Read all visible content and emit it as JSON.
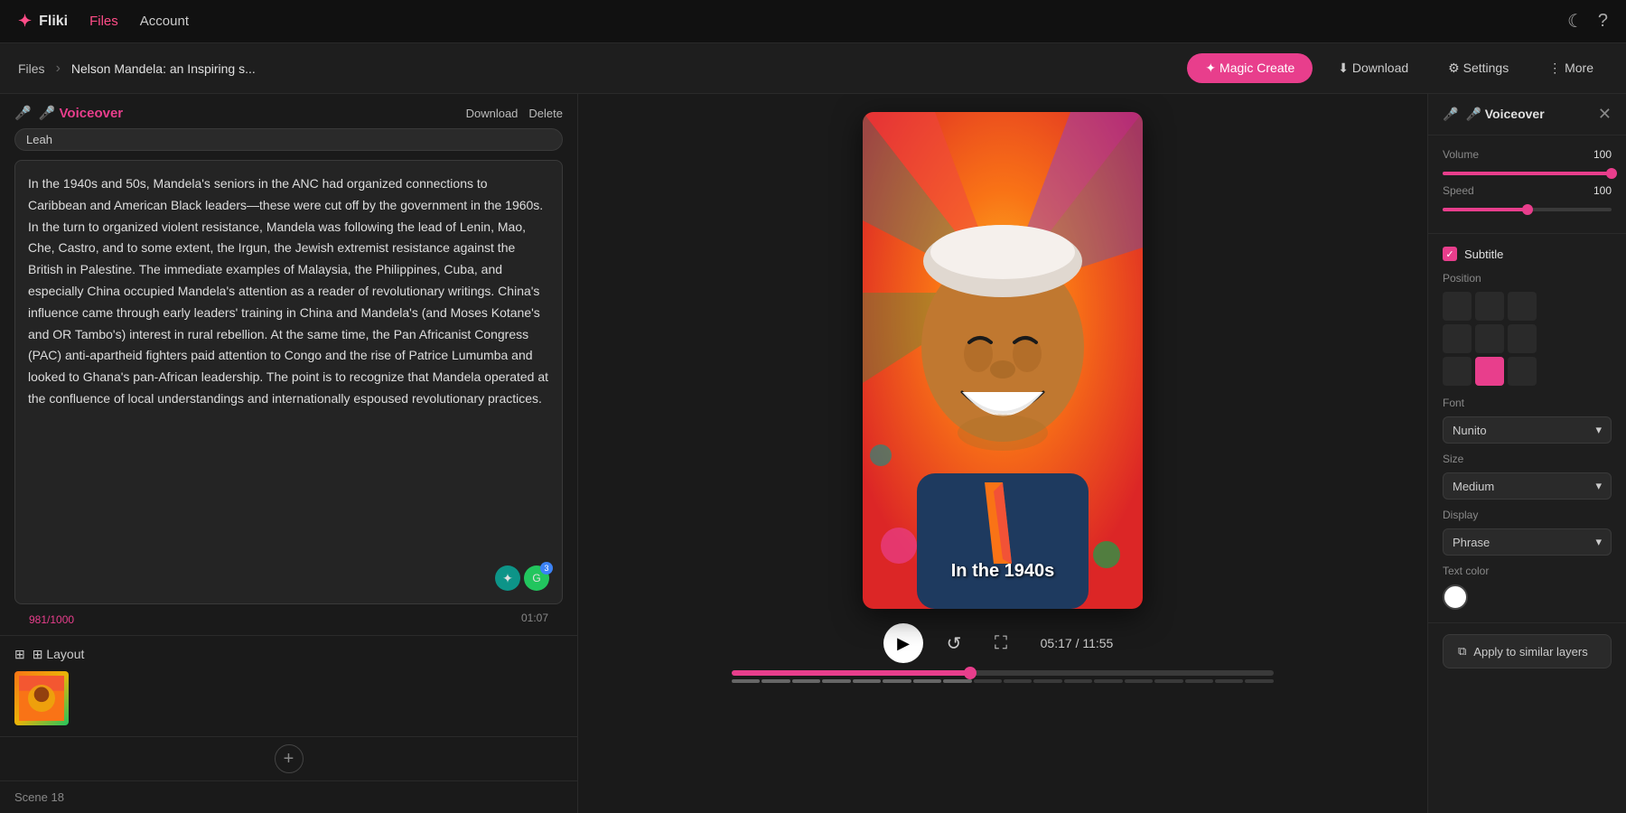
{
  "app": {
    "logo": "✦",
    "name": "Fliki",
    "nav_files": "Files",
    "nav_account": "Account"
  },
  "breadcrumb": {
    "root": "Files",
    "separator": "›",
    "current": "Nelson Mandela: an Inspiring s..."
  },
  "toolbar": {
    "magic_create": "✦ Magic Create",
    "download": "⬇ Download",
    "settings": "⚙ Settings",
    "more": "⋮ More"
  },
  "voiceover": {
    "title": "🎤 Voiceover",
    "download_btn": "Download",
    "delete_btn": "Delete",
    "voice_name": "Leah",
    "text": "In the 1940s and 50s, Mandela's seniors in the ANC had organized connections to Caribbean and American Black leaders—these were cut off by the government in the 1960s. In the turn to organized violent resistance, Mandela was following the lead of Lenin, Mao, Che, Castro, and to some extent, the Irgun, the Jewish extremist resistance against the British in Palestine. The immediate examples of Malaysia, the Philippines, Cuba, and especially China occupied Mandela's attention as a reader of revolutionary writings. China's influence came through early leaders' training in China and Mandela's (and Moses Kotane's and OR Tambo's) interest in rural rebellion. At the same time, the Pan Africanist Congress (PAC) anti-apartheid fighters paid attention to Congo and the rise of Patrice Lumumba and looked to Ghana's pan-African leadership. The point is to recognize that Mandela operated at the confluence of local understandings and internationally espoused revolutionary practices.",
    "char_count": "981/1000",
    "duration": "01:07"
  },
  "layout": {
    "label": "⊞ Layout"
  },
  "scene": {
    "label": "Scene 18",
    "add_icon": "+"
  },
  "video": {
    "subtitle_text": "In the 1940s",
    "time_current": "05:17",
    "time_total": "11:55",
    "time_display": "05:17 / 11:55"
  },
  "right_panel": {
    "title": "🎤 Voiceover",
    "close_icon": "✕",
    "volume_label": "Volume",
    "volume_value": "100",
    "speed_label": "Speed",
    "speed_value": "100",
    "subtitle_label": "Subtitle",
    "position_label": "Position",
    "font_label": "Font",
    "font_value": "Nunito",
    "size_label": "Size",
    "size_value": "Medium",
    "display_label": "Display",
    "display_value": "Phrase",
    "text_color_label": "Text color",
    "apply_btn": "Apply to similar layers",
    "apply_icon": "⧉"
  }
}
